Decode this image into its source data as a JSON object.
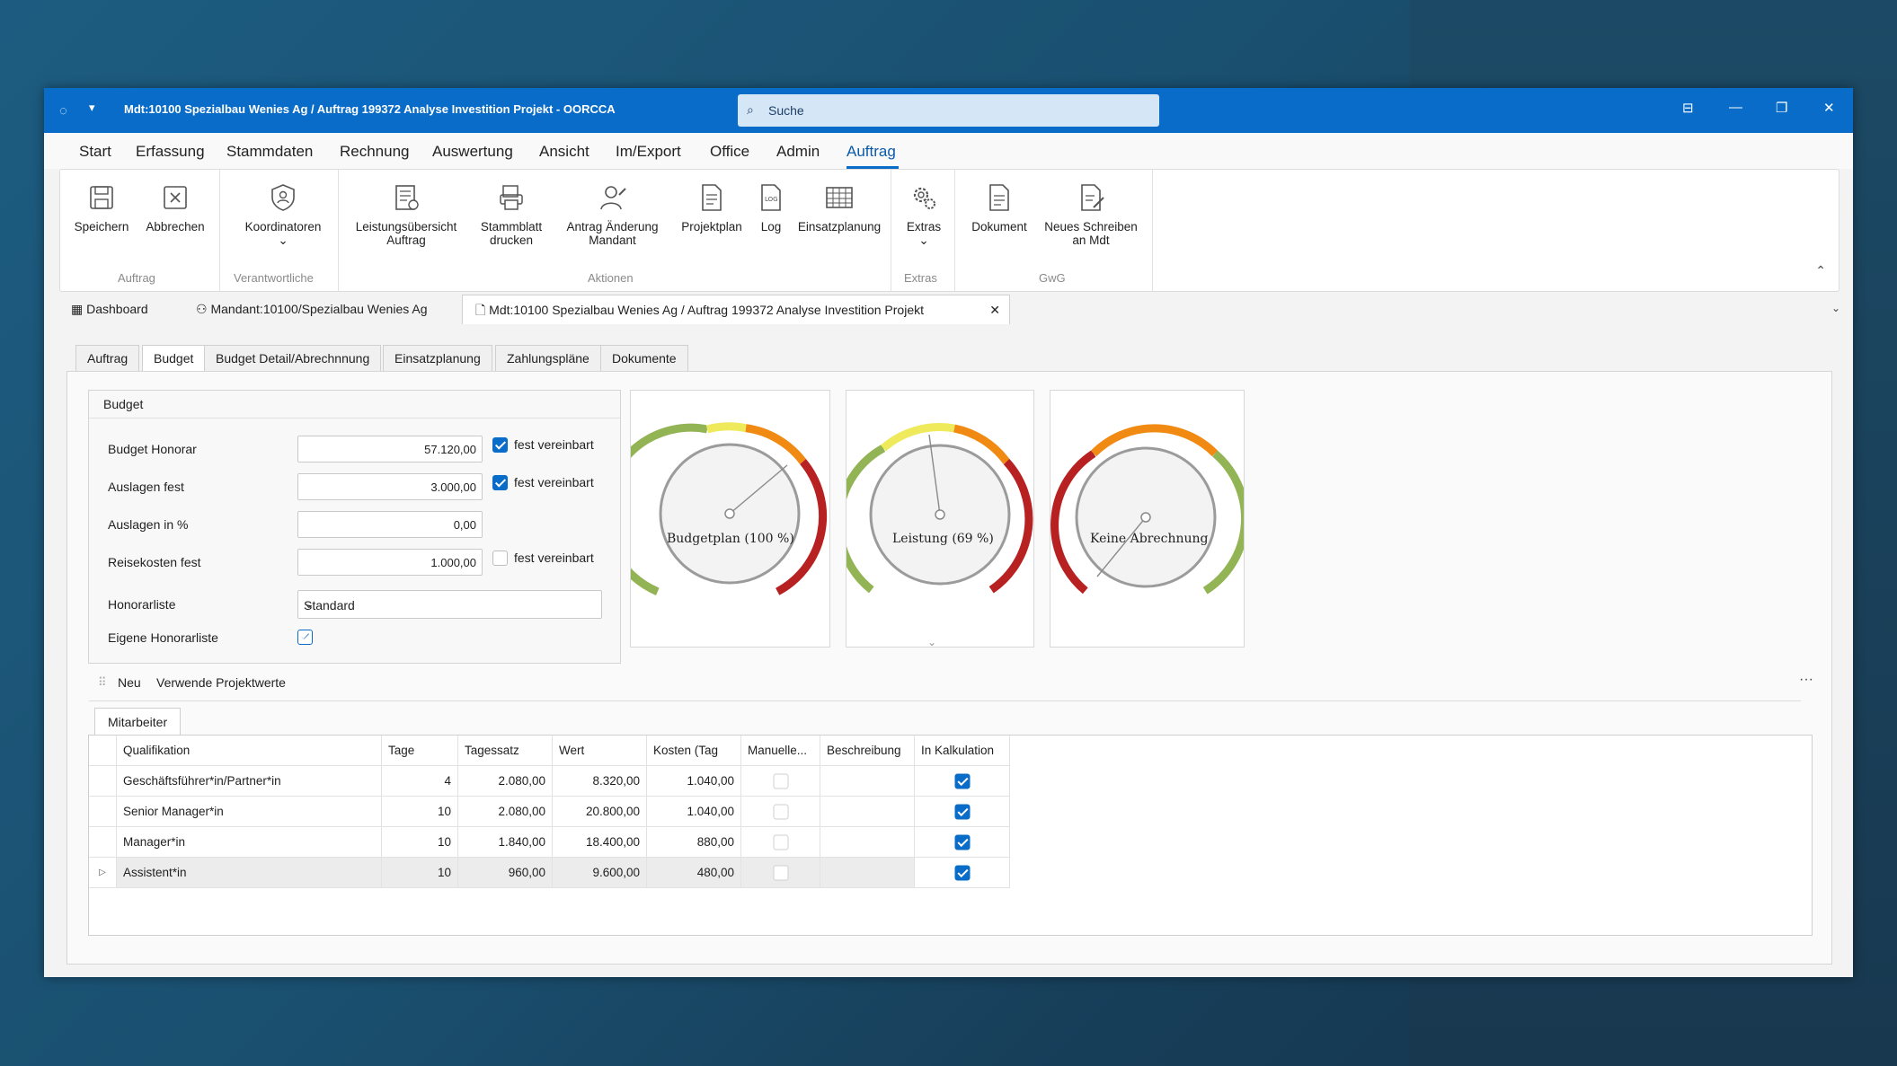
{
  "window": {
    "title": "Mdt:10100 Spezialbau Wenies Ag / Auftrag 199372 Analyse Investition Projekt  - OORCCA"
  },
  "search": {
    "placeholder": "Suche"
  },
  "menu": [
    "Start",
    "Erfassung",
    "Stammdaten",
    "Rechnung",
    "Auswertung",
    "Ansicht",
    "Im/Export",
    "Office",
    "Admin",
    "Auftrag"
  ],
  "menu_active": "Auftrag",
  "ribbon": {
    "buttons": {
      "speichern": "Speichern",
      "abbrechen": "Abbrechen",
      "koordinatoren": "Koordinatoren",
      "leistung1": "Leistungsübersicht",
      "leistung2": "Auftrag",
      "stamm1": "Stammblatt",
      "stamm2": "drucken",
      "antrag1": "Antrag Änderung",
      "antrag2": "Mandant",
      "projektplan": "Projektplan",
      "log": "Log",
      "einsatz": "Einsatzplanung",
      "extras": "Extras",
      "dokument": "Dokument",
      "neues1": "Neues Schreiben",
      "neues2": "an Mdt"
    },
    "groups": {
      "auftrag": "Auftrag",
      "verantwortliche": "Verantwortliche",
      "aktionen": "Aktionen",
      "extras": "Extras",
      "gwg": "GwG"
    }
  },
  "doc_tabs": {
    "dashboard": "Dashboard",
    "mandant": "Mandant:10100/Spezialbau Wenies Ag",
    "auftrag": "Mdt:10100 Spezialbau Wenies Ag / Auftrag 199372 Analyse Investition Projekt"
  },
  "inner_tabs": [
    "Auftrag",
    "Budget",
    "Budget Detail/Abrechnnung",
    "Einsatzplanung",
    "Zahlungspläne",
    "Dokumente"
  ],
  "inner_tab_active": "Budget",
  "budget": {
    "header": "Budget",
    "fields": [
      {
        "label": "Budget Honorar",
        "value": "57.120,00",
        "fest": true,
        "fest_label": "fest vereinbart"
      },
      {
        "label": "Auslagen fest",
        "value": "3.000,00",
        "fest": true,
        "fest_label": "fest vereinbart"
      },
      {
        "label": "Auslagen in %",
        "value": "0,00"
      },
      {
        "label": "Reisekosten fest",
        "value": "1.000,00",
        "fest": false,
        "fest_label": "fest vereinbart"
      }
    ],
    "honorarliste_label": "Honorarliste",
    "honorarliste_value": "Standard",
    "eigene_label": "Eigene Honorarliste",
    "eigene_checked": true
  },
  "gauges": [
    {
      "label": "Budgetplan (100 %)",
      "level": 100
    },
    {
      "label": "Leistung (69 %)",
      "level": 69
    },
    {
      "label": "Keine Abrechnung",
      "level": 0
    }
  ],
  "toolbar": {
    "neu": "Neu",
    "verwende": "Verwende Projektwerte"
  },
  "subtab": "Mitarbeiter",
  "table": {
    "columns": [
      "Qualifikation",
      "Tage",
      "Tagessatz",
      "Wert",
      "Kosten (Tag",
      "Manuelle...",
      "Beschreibung",
      "In Kalkulation"
    ],
    "rows": [
      {
        "qualifikation": "Geschäftsführer*in/Partner*in",
        "tage": "4",
        "tagessatz": "2.080,00",
        "wert": "8.320,00",
        "kosten": "1.040,00",
        "manuell": false,
        "beschreibung": "",
        "kalkulation": true
      },
      {
        "qualifikation": "Senior Manager*in",
        "tage": "10",
        "tagessatz": "2.080,00",
        "wert": "20.800,00",
        "kosten": "1.040,00",
        "manuell": false,
        "beschreibung": "",
        "kalkulation": true
      },
      {
        "qualifikation": "Manager*in",
        "tage": "10",
        "tagessatz": "1.840,00",
        "wert": "18.400,00",
        "kosten": "880,00",
        "manuell": false,
        "beschreibung": "",
        "kalkulation": true
      },
      {
        "qualifikation": "Assistent*in",
        "tage": "10",
        "tagessatz": "960,00",
        "wert": "9.600,00",
        "kosten": "480,00",
        "manuell": false,
        "beschreibung": "",
        "kalkulation": true
      }
    ]
  }
}
